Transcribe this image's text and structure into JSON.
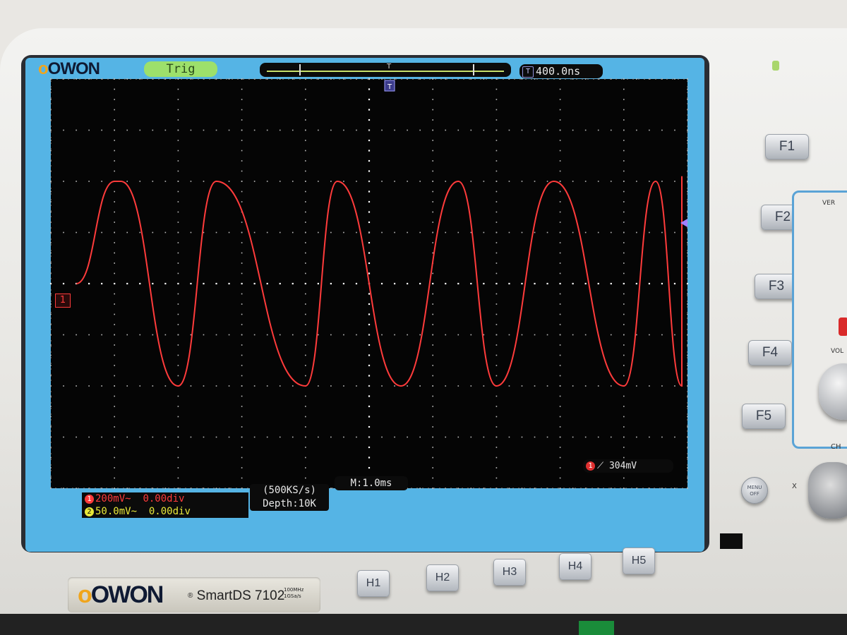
{
  "brand": {
    "logo_top": "OWON",
    "logo_plate": "OWON",
    "model_prefix": "Smart",
    "model": "DS 7102",
    "spec_line1": "100MHz",
    "spec_line2": "1GSa/s"
  },
  "header": {
    "trigger_status": "Trig",
    "trigger_badge": "T",
    "timebase_offset": "400.0ns"
  },
  "screen": {
    "channel_marker": "1",
    "trigger_level_channel": "1",
    "trigger_level": "304mV",
    "channels": [
      {
        "num": "1",
        "scale": "200mV~",
        "offset": "0.00div",
        "color": "#ff3b3b"
      },
      {
        "num": "2",
        "scale": "50.0mV~",
        "offset": "0.00div",
        "color": "#e8e839"
      }
    ],
    "sample_rate": "(500KS/s)",
    "depth": "Depth:10K",
    "main_timebase": "M:1.0ms"
  },
  "function_buttons": [
    "F1",
    "F2",
    "F3",
    "F4",
    "F5"
  ],
  "horizontal_buttons": [
    "H1",
    "H2",
    "H3",
    "H4",
    "H5"
  ],
  "menu_off": {
    "line1": "MENU",
    "line2": "OFF"
  },
  "side_panel": {
    "ver_label": "VER",
    "vol_label": "VOL",
    "ch_label": "CH",
    "x_label": "X"
  },
  "chart_data": {
    "type": "line",
    "series": [
      {
        "color": "#ff3b3b",
        "x": [
          -4.6,
          -4.0,
          -3.9,
          -3.0,
          -2.4,
          -1.0,
          -0.5,
          0.5,
          1.4,
          2.0,
          2.9,
          4.0,
          4.5,
          5.5,
          6.2,
          7.0,
          8.0,
          8.8,
          9.6
        ],
        "y": [
          0.0,
          2.0,
          2.0,
          -2.0,
          2.0,
          -2.0,
          2.0,
          -2.0,
          2.0,
          -2.0,
          2.0,
          -2.0,
          2.0,
          -2.0,
          2.0,
          -2.0,
          2.0,
          -1.7,
          2.1
        ]
      }
    ],
    "xlim": [
      -5,
      5
    ],
    "ylim": [
      -4,
      4
    ],
    "grid": true
  }
}
